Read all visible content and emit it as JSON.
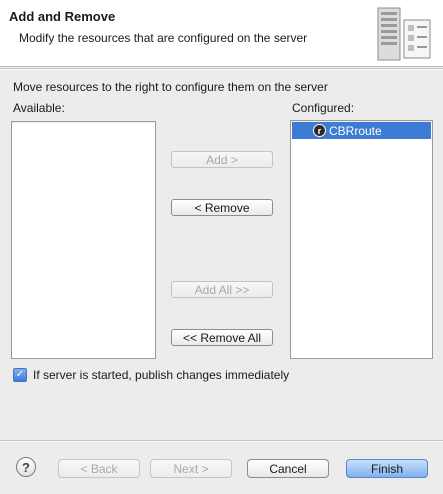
{
  "header": {
    "title": "Add and Remove",
    "subtitle": "Modify the resources that are configured on the server",
    "icon": "server-wizard-icon"
  },
  "body": {
    "instructions": "Move resources to the right to configure them on the server",
    "available_label": "Available:",
    "configured_label": "Configured:",
    "available_items": [],
    "configured_items": [
      {
        "label": "CBRroute",
        "icon": "route-icon",
        "icon_glyph": "r",
        "selected": true
      }
    ],
    "buttons": {
      "add": "Add >",
      "remove": "< Remove",
      "add_all": "Add All >>",
      "remove_all": "<< Remove All"
    },
    "publish_checkbox": {
      "label": "If server is started, publish changes immediately",
      "checked": true
    }
  },
  "footer": {
    "help": "?",
    "back": "< Back",
    "next": "Next >",
    "cancel": "Cancel",
    "finish": "Finish"
  },
  "colors": {
    "selection": "#3d7bd4",
    "default_button": "#7fb2ee",
    "dialog_bg": "#ececec"
  }
}
